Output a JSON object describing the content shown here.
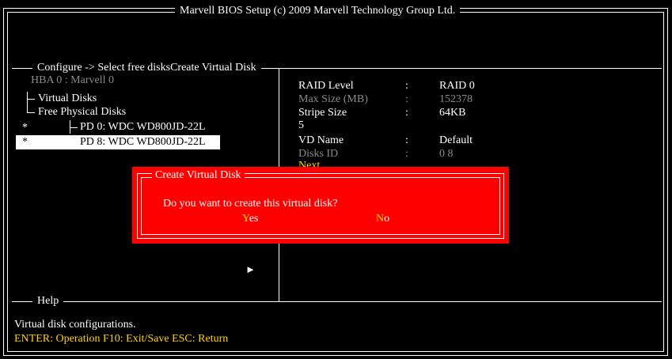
{
  "window": {
    "title": "Marvell BIOS Setup (c) 2009 Marvell Technology Group Ltd."
  },
  "config": {
    "title": "Configure -> Select free disksCreate Virtual Disk"
  },
  "tree": {
    "hba": "HBA  0 :  Marvell 0",
    "virtual_disks": "Virtual Disks",
    "free_physical_disks": "Free Physical Disks",
    "disks": [
      {
        "marker": "*",
        "label": "PD 0: WDC WD800JD-22L"
      },
      {
        "marker": "*",
        "label": "PD 8: WDC WD800JD-22L"
      }
    ]
  },
  "details": {
    "raid_level": {
      "label": "RAID Level",
      "value": "RAID  0"
    },
    "max_size": {
      "label": "Max Size (MB)",
      "value": "152378"
    },
    "stripe_size": {
      "label": "Stripe Size",
      "value": "64KB"
    },
    "stripe_extra": "5",
    "vd_name": {
      "label": "VD Name",
      "value": "Default"
    },
    "disks_id": {
      "label": "Disks ID",
      "value": "0 8"
    },
    "next_partial": "Next",
    "colon": ":"
  },
  "dialog": {
    "title": "Create Virtual Disk",
    "message": "Do you want to create this virtual disk?",
    "yes_hotkey": "Y",
    "yes_rest": "es",
    "no_hotkey": "N",
    "no_rest": "o"
  },
  "help": {
    "title": "Help",
    "text": "Virtual disk configurations.",
    "keys": "ENTER: Operation   F10: Exit/Save   ESC: Return"
  },
  "arrow_glyph": "►",
  "colors": {
    "background": "#000000",
    "dialog": "#ff0000",
    "hotkey": "#ffd200",
    "disabled": "#8a8a8a"
  }
}
